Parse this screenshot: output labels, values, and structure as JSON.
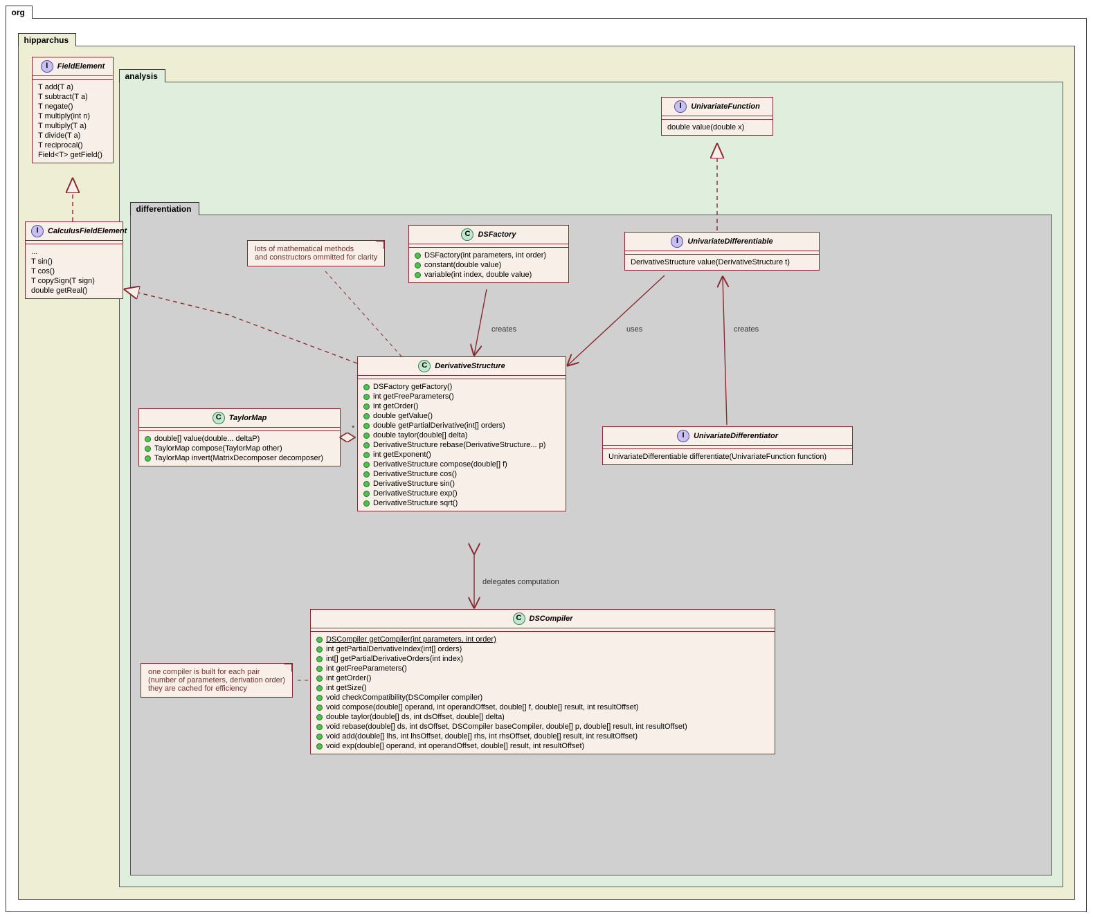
{
  "packages": {
    "org": "org",
    "hipparchus": "hipparchus",
    "analysis": "analysis",
    "differentiation": "differentiation"
  },
  "classes": {
    "FieldElement": {
      "stereotype": "I",
      "name": "FieldElement",
      "members": [
        "T add(T a)",
        "T subtract(T a)",
        "T negate()",
        "T multiply(int n)",
        "T multiply(T a)",
        "T divide(T a)",
        "T reciprocal()",
        "Field<T> getField()"
      ]
    },
    "CalculusFieldElement": {
      "stereotype": "I",
      "name": "CalculusFieldElement",
      "members": [
        "...",
        "T sin()",
        "T cos()",
        "T copySign(T sign)",
        "double getReal()"
      ]
    },
    "UnivariateFunction": {
      "stereotype": "I",
      "name": "UnivariateFunction",
      "members": [
        "double value(double x)"
      ]
    },
    "DSFactory": {
      "stereotype": "C",
      "name": "DSFactory",
      "members": [
        "DSFactory(int parameters, int order)",
        "constant(double value)",
        "variable(int index, double value)"
      ]
    },
    "UnivariateDifferentiable": {
      "stereotype": "I",
      "name": "UnivariateDifferentiable",
      "members": [
        "DerivativeStructure value(DerivativeStructure t)"
      ]
    },
    "TaylorMap": {
      "stereotype": "C",
      "name": "TaylorMap",
      "members": [
        "double[] value(double... deltaP)",
        "TaylorMap compose(TaylorMap other)",
        "TaylorMap invert(MatrixDecomposer decomposer)"
      ]
    },
    "DerivativeStructure": {
      "stereotype": "C",
      "name": "DerivativeStructure",
      "members": [
        "DSFactory getFactory()",
        "int getFreeParameters()",
        "int getOrder()",
        "double getValue()",
        "double getPartialDerivative(int[] orders)",
        "double taylor(double[] delta)",
        "DerivativeStructure rebase(DerivativeStructure... p)",
        "int getExponent()",
        "DerivativeStructure compose(double[] f)",
        "DerivativeStructure cos()",
        "DerivativeStructure sin()",
        "DerivativeStructure exp()",
        "DerivativeStructure sqrt()"
      ]
    },
    "UnivariateDifferentiator": {
      "stereotype": "I",
      "name": "UnivariateDifferentiator",
      "members": [
        "UnivariateDifferentiable differentiate(UnivariateFunction function)"
      ]
    },
    "DSCompiler": {
      "stereotype": "C",
      "name": "DSCompiler",
      "members": [
        "DSCompiler getCompiler(int parameters, int order)",
        "int getPartialDerivativeIndex(int[] orders)",
        "int[] getPartialDerivativeOrders(int index)",
        "int getFreeParameters()",
        "int getOrder()",
        "int getSize()",
        "void checkCompatibility(DSCompiler compiler)",
        "void compose(double[] operand, int operandOffset, double[] f, double[] result, int resultOffset)",
        "double taylor(double[] ds, int dsOffset, double[] delta)",
        "void rebase(double[] ds, int dsOffset, DSCompiler baseCompiler, double[] p, double[] result, int resultOffset)",
        "void add(double[] lhs, int lhsOffset, double[] rhs, int rhsOffset, double[] result, int resultOffset)",
        "void exp(double[] operand, int operandOffset, double[] result, int resultOffset)"
      ]
    }
  },
  "notes": {
    "note1": [
      "lots of mathematical methods",
      "and constructors ommitted for clarity"
    ],
    "note2": [
      "one compiler is built for each pair",
      "(number of parameters, derivation order)",
      "they are cached for efficiency"
    ]
  },
  "labels": {
    "creates1": "creates",
    "uses": "uses",
    "creates2": "creates",
    "delegates": "delegates computation",
    "star": "*"
  }
}
